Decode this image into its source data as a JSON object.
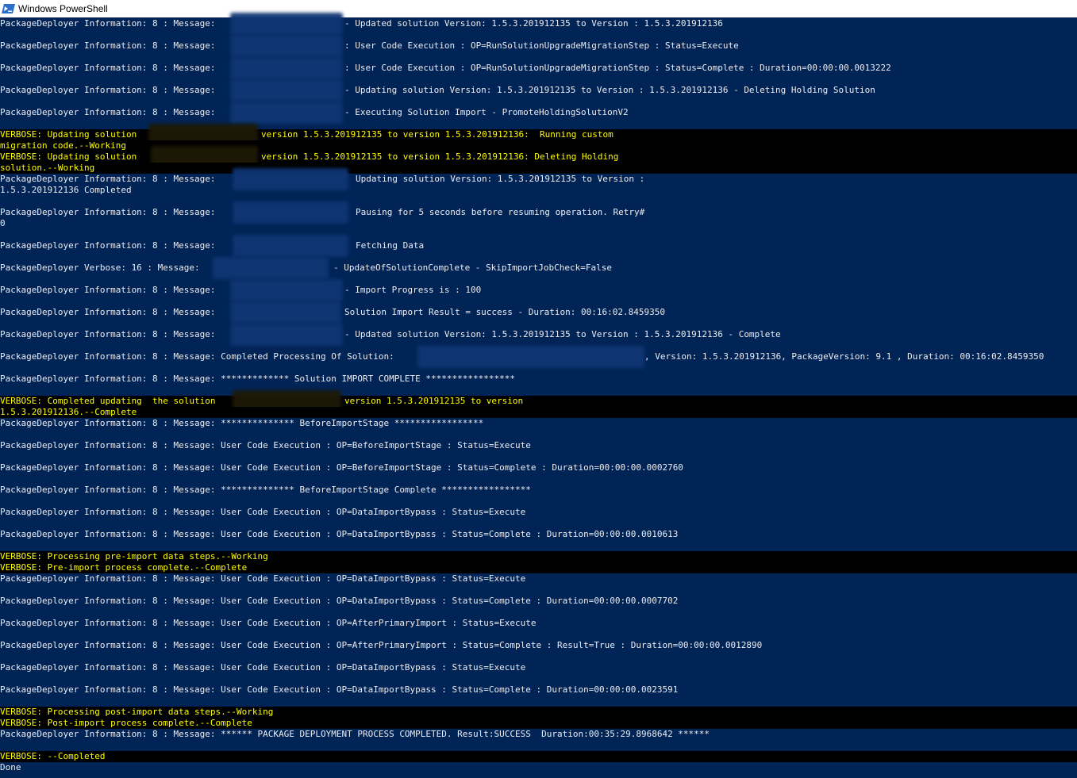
{
  "window": {
    "title": "Windows PowerShell",
    "icon": "powershell-icon"
  },
  "colors": {
    "background": "#012456",
    "text": "#eeedf0",
    "verbose_fg": "#ffff00",
    "verbose_bg": "#000000"
  },
  "console": {
    "l1": {
      "a": "PackageDeployer Information: 8 : Message:",
      "b": "- Updated solution Version: 1.5.3.201912135 to Version : 1.5.3.201912136"
    },
    "l2": {
      "a": "PackageDeployer Information: 8 : Message:",
      "b": ": User Code Execution : OP=RunSolutionUpgradeMigrationStep : Status=Execute"
    },
    "l3": {
      "a": "PackageDeployer Information: 8 : Message:",
      "b": ": User Code Execution : OP=RunSolutionUpgradeMigrationStep : Status=Complete : Duration=00:00:00.0013222"
    },
    "l4": {
      "a": "PackageDeployer Information: 8 : Message:",
      "b": "- Updating solution Version: 1.5.3.201912135 to Version : 1.5.3.201912136 - Deleting Holding Solution"
    },
    "l5": {
      "a": "PackageDeployer Information: 8 : Message:",
      "b": "- Executing Solution Import - PromoteHoldingSolutionV2"
    },
    "v1a": {
      "a": "VERBOSE: Updating solution",
      "b": "version 1.5.3.201912135 to version 1.5.3.201912136:  Running custom"
    },
    "v1b": {
      "a": "migration code.--Working"
    },
    "v2a": {
      "a": "VERBOSE: Updating solution",
      "b": "version 1.5.3.201912135 to version 1.5.3.201912136: Deleting Holding"
    },
    "v2b": {
      "a": "solution.--Working"
    },
    "l6a": {
      "a": "PackageDeployer Information: 8 : Message:",
      "b": "Updating solution Version: 1.5.3.201912135 to Version :"
    },
    "l6b": {
      "a": "1.5.3.201912136 Completed"
    },
    "l7a": {
      "a": "PackageDeployer Information: 8 : Message:",
      "b": "Pausing for 5 seconds before resuming operation. Retry#"
    },
    "l7b": {
      "a": "0"
    },
    "l8": {
      "a": "PackageDeployer Information: 8 : Message:",
      "b": "Fetching Data"
    },
    "l9": {
      "a": "PackageDeployer Verbose: 16 : Message:",
      "b": "- UpdateOfSolutionComplete - SkipImportJobCheck=False"
    },
    "l10": {
      "a": "PackageDeployer Information: 8 : Message:",
      "b": "- Import Progress is : 100"
    },
    "l11": {
      "a": "PackageDeployer Information: 8 : Message:",
      "b": "Solution Import Result = success - Duration: 00:16:02.8459350"
    },
    "l12": {
      "a": "PackageDeployer Information: 8 : Message:",
      "b": "- Updated solution Version: 1.5.3.201912135 to Version : 1.5.3.201912136 - Complete"
    },
    "l13": {
      "a": "PackageDeployer Information: 8 : Message: Completed Processing Of Solution:",
      "b": ", Version: 1.5.3.201912136, PackageVersion: 9.1 , Duration: 00:16:02.8459350"
    },
    "l14": {
      "a": "PackageDeployer Information: 8 : Message: ************* Solution IMPORT COMPLETE *****************"
    },
    "v3a": {
      "a": "VERBOSE: Completed updating  the solution",
      "b": "version 1.5.3.201912135 to version"
    },
    "v3b": {
      "a": "1.5.3.201912136.--Complete"
    },
    "l15": {
      "a": "PackageDeployer Information: 8 : Message: ************** BeforeImportStage *****************"
    },
    "l16": {
      "a": "PackageDeployer Information: 8 : Message: User Code Execution : OP=BeforeImportStage : Status=Execute"
    },
    "l17": {
      "a": "PackageDeployer Information: 8 : Message: User Code Execution : OP=BeforeImportStage : Status=Complete : Duration=00:00:00.0002760"
    },
    "l18": {
      "a": "PackageDeployer Information: 8 : Message: ************** BeforeImportStage Complete *****************"
    },
    "l19": {
      "a": "PackageDeployer Information: 8 : Message: User Code Execution : OP=DataImportBypass : Status=Execute"
    },
    "l20": {
      "a": "PackageDeployer Information: 8 : Message: User Code Execution : OP=DataImportBypass : Status=Complete : Duration=00:00:00.0010613"
    },
    "v4": {
      "a": "VERBOSE: Processing pre-import data steps.--Working"
    },
    "v5": {
      "a": "VERBOSE: Pre-import process complete.--Complete"
    },
    "l21": {
      "a": "PackageDeployer Information: 8 : Message: User Code Execution : OP=DataImportBypass : Status=Execute"
    },
    "l22": {
      "a": "PackageDeployer Information: 8 : Message: User Code Execution : OP=DataImportBypass : Status=Complete : Duration=00:00:00.0007702"
    },
    "l23": {
      "a": "PackageDeployer Information: 8 : Message: User Code Execution : OP=AfterPrimaryImport : Status=Execute"
    },
    "l24": {
      "a": "PackageDeployer Information: 8 : Message: User Code Execution : OP=AfterPrimaryImport : Status=Complete : Result=True : Duration=00:00:00.0012890"
    },
    "l25": {
      "a": "PackageDeployer Information: 8 : Message: User Code Execution : OP=DataImportBypass : Status=Execute"
    },
    "l26": {
      "a": "PackageDeployer Information: 8 : Message: User Code Execution : OP=DataImportBypass : Status=Complete : Duration=00:00:00.0023591"
    },
    "v6": {
      "a": "VERBOSE: Processing post-import data steps.--Working"
    },
    "v7": {
      "a": "VERBOSE: Post-import process complete.--Complete"
    },
    "l27": {
      "a": "PackageDeployer Information: 8 : Message: ****** PACKAGE DEPLOYMENT PROCESS COMPLETED. Result:SUCCESS  Duration:00:35:29.8968642 ******"
    },
    "v8": {
      "a": "VERBOSE: --Completed"
    },
    "done": {
      "a": "Done"
    }
  }
}
